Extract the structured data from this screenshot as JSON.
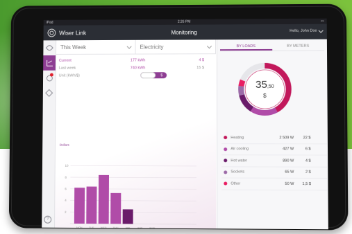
{
  "status_bar": {
    "carrier": "iPad",
    "time": "2:26 PM"
  },
  "navbar": {
    "brand": "Wiser Link",
    "title": "Monitoring",
    "greeting": "Hello, John Doe"
  },
  "sidebar": {
    "help": "?"
  },
  "filters": {
    "period": "This Week",
    "energy": "Electricity"
  },
  "tabs": {
    "loads": "BY LOADS",
    "meters": "BY METERS"
  },
  "stats": [
    {
      "label": "Current",
      "kwh": "177 kWh",
      "cost": "4 $"
    },
    {
      "label": "Last week",
      "kwh": "740 kWh",
      "cost": "15 $"
    }
  ],
  "unit": {
    "label": "Unit (kWh/$)",
    "selected": "$"
  },
  "total": {
    "integer": "35",
    "decimal": ",50",
    "currency": "$"
  },
  "loads": [
    {
      "name": "Heating",
      "watts": "2 509 W",
      "cost": "22 $",
      "color": "#c2185b",
      "share": 0.42
    },
    {
      "name": "Air cooling",
      "watts": "427 W",
      "cost": "6 $",
      "color": "#b04ca8",
      "share": 0.17
    },
    {
      "name": "Hot water",
      "watts": "890 W",
      "cost": "4 $",
      "color": "#6a1b6a",
      "share": 0.12
    },
    {
      "name": "Sockets",
      "watts": "65 W",
      "cost": "2 $",
      "color": "#9c6aa8",
      "share": 0.06
    },
    {
      "name": "Other",
      "watts": "50 W",
      "cost": "1,5 $",
      "color": "#e91e63",
      "share": 0.04
    }
  ],
  "colors": {
    "accent": "#8e3e93",
    "bar": "#b04ca8",
    "bar_current": "#6a1b6a",
    "donut_track": "#e6e6ea"
  },
  "chart_data": {
    "type": "bar",
    "ylabel": "Dollars",
    "yticks": [
      "10",
      "8",
      "6",
      "4",
      "2"
    ],
    "ylim": [
      0,
      12
    ],
    "categories": [
      "MON",
      "TUE",
      "WED",
      "THU",
      "FRI",
      "SAT",
      "SUN"
    ],
    "values": [
      6.2,
      6.4,
      8.4,
      5.3,
      2.5,
      0,
      0
    ]
  }
}
